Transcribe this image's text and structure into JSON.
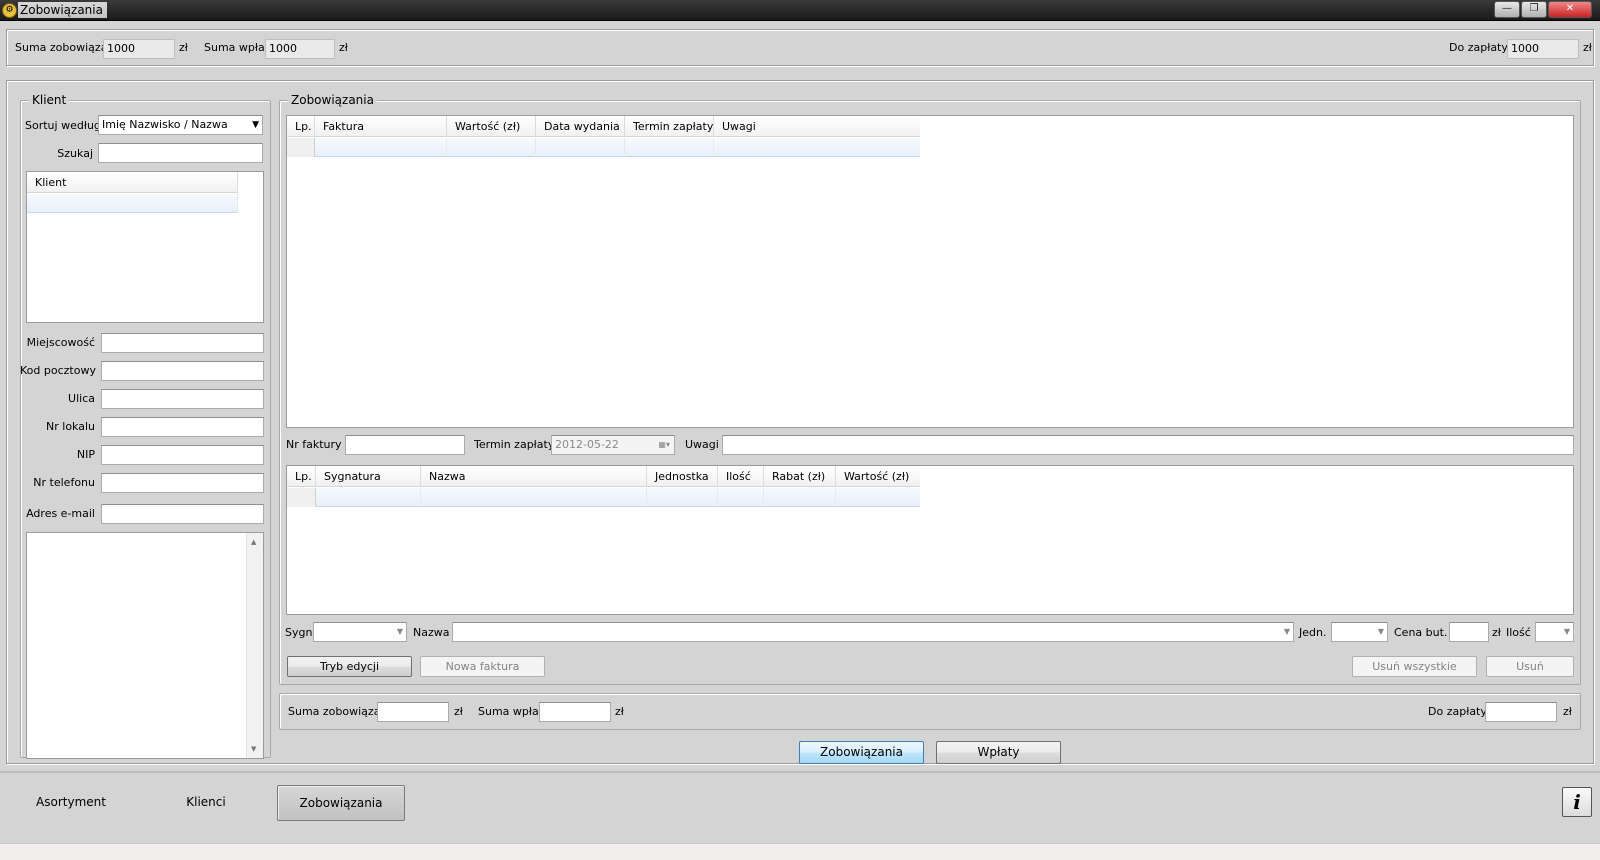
{
  "window": {
    "title": "Zobowiązania"
  },
  "summary_top": {
    "suma_zobowiazan_label": "Suma zobowiązań",
    "suma_zobowiazan_value": "1000",
    "suma_wplat_label": "Suma wpłat",
    "suma_wplat_value": "1000",
    "do_zaplaty_label": "Do zapłaty",
    "do_zaplaty_value": "1000",
    "currency": "zł"
  },
  "client_panel": {
    "title": "Klient",
    "sort_label": "Sortuj według",
    "sort_value": "Imię  Nazwisko / Nazwa",
    "search_label": "Szukaj",
    "search_value": "",
    "list_header": "Klient",
    "fields": {
      "miejscowosc": "Miejscowość",
      "kod_pocztowy": "Kod pocztowy",
      "ulica": "Ulica",
      "nr_lokalu": "Nr lokalu",
      "nip": "NIP",
      "nr_telefonu": "Nr telefonu",
      "adres_email": "Adres e-mail"
    }
  },
  "obligations_panel": {
    "title": "Zobowiązania",
    "invoice_columns": [
      "Lp.",
      "Faktura",
      "Wartość (zł)",
      "Data wydania",
      "Termin zapłaty",
      "Uwagi"
    ],
    "nr_faktury_label": "Nr faktury",
    "termin_zaplaty_label": "Termin zapłaty",
    "termin_zaplaty_value": "2012-05-22",
    "uwagi_label": "Uwagi",
    "item_columns": [
      "Lp.",
      "Sygnatura",
      "Nazwa",
      "Jednostka",
      "Ilość",
      "Rabat (zł)",
      "Wartość (zł)"
    ],
    "sygn_label": "Sygn",
    "nazwa_label": "Nazwa",
    "jedn_label": "Jedn.",
    "cena_label": "Cena  but.",
    "currency": "zł",
    "ilosc_label": "Ilość",
    "buttons": {
      "tryb_edycji": "Tryb edycji",
      "nowa_faktura": "Nowa faktura",
      "usun_wszystkie": "Usuń wszystkie",
      "usun": "Usuń"
    }
  },
  "summary_bottom": {
    "suma_zobowiazan_label": "Suma zobowiązań",
    "suma_wplat_label": "Suma wpłat",
    "do_zaplaty_label": "Do zapłaty",
    "currency": "zł"
  },
  "mode_buttons": {
    "zobowiazania": "Zobowiązania",
    "wplaty": "Wpłaty"
  },
  "nav": {
    "asortyment": "Asortyment",
    "klienci": "Klienci",
    "zobowiazania": "Zobowiązania",
    "info": "i"
  }
}
